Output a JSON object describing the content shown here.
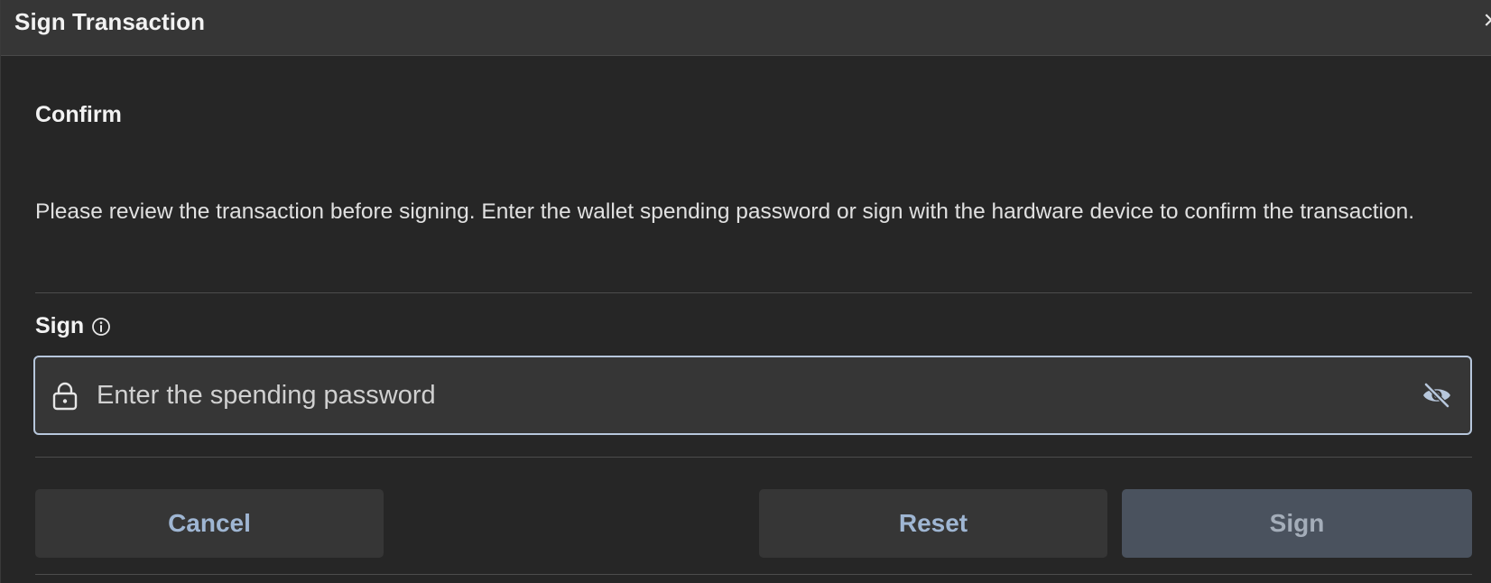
{
  "dialog": {
    "title": "Sign Transaction",
    "close_symbol": "×"
  },
  "confirm": {
    "heading": "Confirm",
    "description": "Please review the transaction before signing. Enter the wallet spending password or sign with the hardware device to confirm the transaction."
  },
  "sign": {
    "label": "Sign",
    "info_icon": "info-circle-icon",
    "password_field": {
      "placeholder": "Enter the spending password",
      "value": "",
      "left_icon": "lock-icon",
      "right_icon": "eye-off-icon"
    }
  },
  "actions": {
    "cancel_label": "Cancel",
    "reset_label": "Reset",
    "sign_label": "Sign"
  },
  "colors": {
    "background": "#262626",
    "header": "#363636",
    "field_border": "#b7c7dc",
    "button_text": "#9fb6d3",
    "sign_button_bg": "#4a525e"
  }
}
